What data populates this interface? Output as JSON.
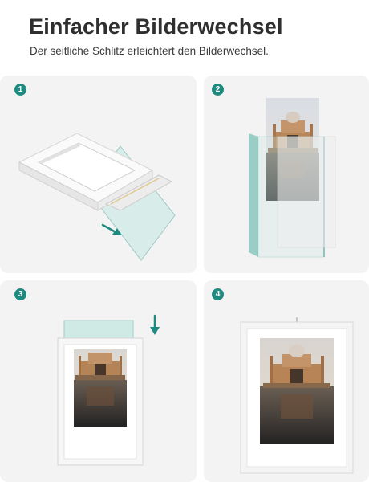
{
  "header": {
    "title": "Einfacher Bilderwechsel",
    "subtitle": "Der seitliche Schlitz erleichtert den Bilderwechsel."
  },
  "steps": [
    {
      "number": "1"
    },
    {
      "number": "2"
    },
    {
      "number": "3"
    },
    {
      "number": "4"
    }
  ],
  "colors": {
    "accent": "#1f8a80",
    "panel_background": "#f3f3f3",
    "frame_white": "#fafafa",
    "glass": "#bfe3dd"
  }
}
